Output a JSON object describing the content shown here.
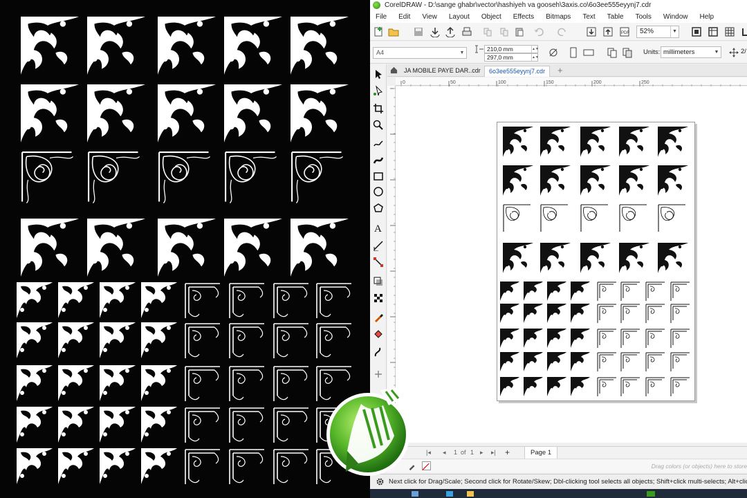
{
  "window": {
    "title": "CorelDRAW - D:\\sange ghabr\\vector\\hashiyeh va gooseh\\3axis.co\\6o3ee555eyynj7.cdr"
  },
  "menu": [
    "File",
    "Edit",
    "View",
    "Layout",
    "Object",
    "Effects",
    "Bitmaps",
    "Text",
    "Table",
    "Tools",
    "Window",
    "Help"
  ],
  "toolbar": {
    "zoom": "52%"
  },
  "property_bar": {
    "page_size": "A4",
    "width": "210,0 mm",
    "height": "297,0 mm",
    "units_label": "Units:",
    "units_value": "millimeters",
    "nudge": "2/"
  },
  "document_tabs": [
    {
      "label": "JA MOBILE PAYE DAR..cdr",
      "active": false
    },
    {
      "label": "6o3ee555eyynj7.cdr",
      "active": true
    }
  ],
  "ruler": {
    "h_ticks": [
      "0",
      "50",
      "100",
      "150",
      "200",
      "250"
    ],
    "v_ticks": [
      "300",
      "250",
      "200",
      "150",
      "100",
      "50",
      "0"
    ]
  },
  "page_nav": {
    "position": "1",
    "of_label": "of",
    "total": "1",
    "page_tab": "Page 1"
  },
  "docker_hint": "Drag colors (or objects) here to store",
  "status": {
    "message": "Next click for Drag/Scale; Second click for Rotate/Skew; Dbl-clicking tool selects all objects; Shift+click multi-selects; Alt+click digs"
  },
  "icons": {
    "app": "coreldraw-logo-icon",
    "logo": "coreldraw-pen-logo"
  },
  "colors": {
    "logo_green": "#3a9a1e",
    "logo_light": "#9be05a",
    "active_tab_text": "#1b57a8"
  }
}
